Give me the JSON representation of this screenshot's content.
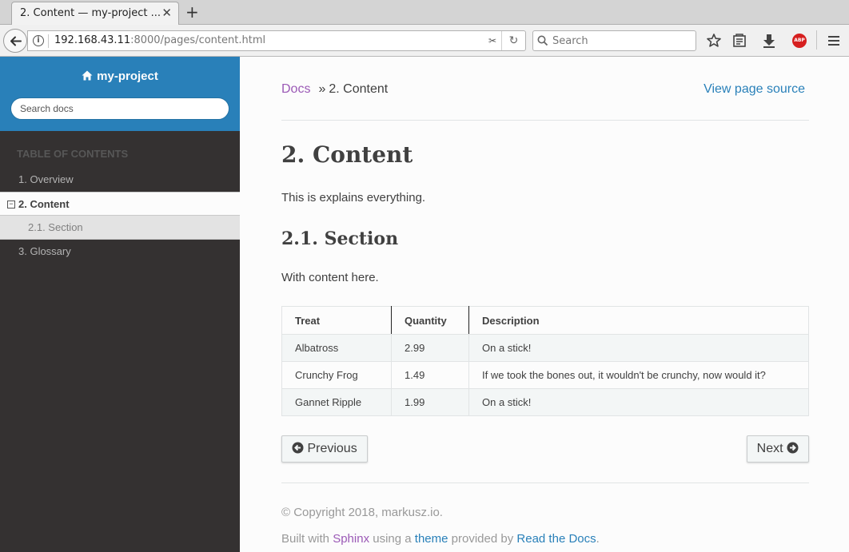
{
  "browser": {
    "tab_title": "2. Content — my-project ...",
    "tab_close": "✕",
    "new_tab": "+",
    "url_host": "192.168.43.11",
    "url_path": ":8000/pages/content.html",
    "search_placeholder": "Search",
    "toolbar_icons": [
      "back-icon",
      "info-icon",
      "reader-icon",
      "reload-icon",
      "search-icon",
      "bookmark-star-icon",
      "library-icon",
      "download-icon",
      "adblock-icon",
      "menu-icon"
    ],
    "abp_label": "ABP"
  },
  "sidebar": {
    "project": "my-project",
    "search_placeholder": "Search docs",
    "caption": "TABLE OF CONTENTS",
    "items": [
      {
        "label": "1. Overview"
      },
      {
        "label": "2. Content",
        "expander": "−"
      },
      {
        "label": "2.1. Section"
      },
      {
        "label": "3. Glossary"
      }
    ]
  },
  "main": {
    "breadcrumb_docs": "Docs",
    "breadcrumb_sep": "»",
    "breadcrumb_current": "2. Content",
    "view_source": "View page source",
    "title": "2. Content",
    "intro": "This is explains everything.",
    "section_title": "2.1. Section",
    "section_text": "With content here.",
    "table": {
      "headers": [
        "Treat",
        "Quantity",
        "Description"
      ],
      "rows": [
        [
          "Albatross",
          "2.99",
          "On a stick!"
        ],
        [
          "Crunchy Frog",
          "1.49",
          "If we took the bones out, it wouldn't be crunchy, now would it?"
        ],
        [
          "Gannet Ripple",
          "1.99",
          "On a stick!"
        ]
      ]
    },
    "previous": "Previous",
    "next": "Next",
    "copyright": "© Copyright 2018, markusz.io.",
    "built_prefix": "Built with",
    "built_sphinx": "Sphinx",
    "built_using": "using a",
    "built_theme": "theme",
    "built_provided": "provided by",
    "built_rtd": "Read the Docs",
    "built_end": "."
  },
  "colors": {
    "sidebar_top": "#2980b9",
    "sidebar_bg": "#343131",
    "link": "#2980b9",
    "visited_link": "#9b59b6",
    "text": "#404040"
  }
}
